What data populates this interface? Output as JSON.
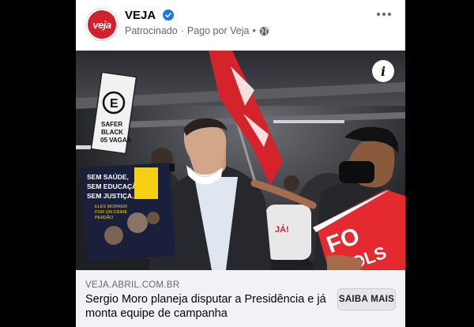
{
  "post": {
    "page_name": "VEJA",
    "avatar_text": "veja",
    "sponsored_label": "Patrocinado",
    "separator": "·",
    "paid_by": "Pago por Veja",
    "separator2": "•",
    "icons": {
      "verified": "verified-badge-icon",
      "audience": "globe-icon",
      "more": "more-options-icon",
      "info": "info-icon"
    },
    "accent_color": "#1877f2",
    "brand_color": "#d3212b"
  },
  "photo": {
    "sign_top": [
      "SAFER",
      "BLACK",
      "05 VAGAS"
    ],
    "sign_letter": "E",
    "protest_sign": [
      "SEM SAÚDE,",
      "SEM EDUCAÇÃO,",
      "SEM JUSTIÇA."
    ],
    "protest_sign_small": [
      "ELES MORREM",
      "POR UM CRIME",
      "PERDÃO"
    ],
    "fo_sign": [
      "FO",
      "OLS"
    ],
    "shirt_text": "JÁ!"
  },
  "link": {
    "domain": "VEJA.ABRIL.COM.BR",
    "headline": "Sergio Moro planeja disputar a Presidência e já monta equipe de campanha",
    "cta_label": "SAIBA MAIS"
  }
}
